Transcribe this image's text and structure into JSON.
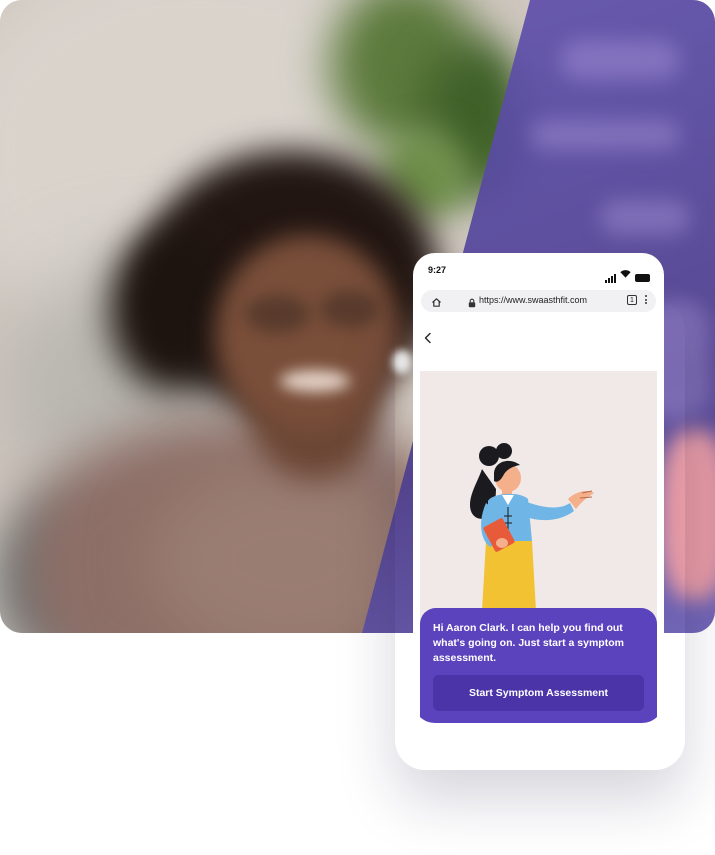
{
  "status_bar": {
    "time": "9:27",
    "icons": [
      "signal-icon",
      "wifi-icon",
      "battery-icon"
    ]
  },
  "browser": {
    "url": "https://www.swaasthfit.com",
    "tab_count": "1",
    "icons": [
      "home-icon",
      "lock-icon",
      "tabs-icon",
      "more-icon"
    ]
  },
  "page": {
    "back_icon": "chevron-left-icon"
  },
  "assistant": {
    "message": "Hi Aaron Clark. I can help you find out what's going on. Just start a symptom assessment.",
    "cta_label": "Start Symptom Assessment"
  },
  "colors": {
    "accent": "#5a43bd",
    "cta": "#4a34a8",
    "illustration_bg": "#f0e9e7"
  }
}
